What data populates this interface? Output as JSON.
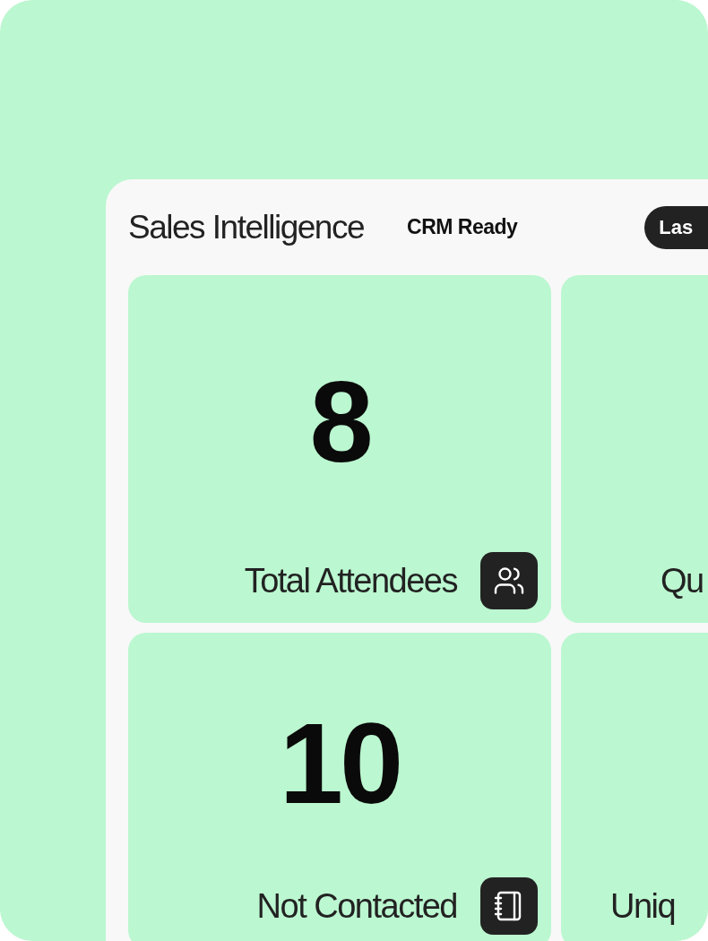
{
  "header": {
    "title": "Sales Intelligence",
    "status": "CRM Ready",
    "range_button": "Las"
  },
  "cards": [
    {
      "kind": "full",
      "value": "8",
      "label": "Total Attendees"
    },
    {
      "kind": "cut",
      "label": "Qu"
    },
    {
      "kind": "full",
      "value": "10",
      "label": "Not Contacted"
    },
    {
      "kind": "cut",
      "label": "Uniq"
    }
  ]
}
